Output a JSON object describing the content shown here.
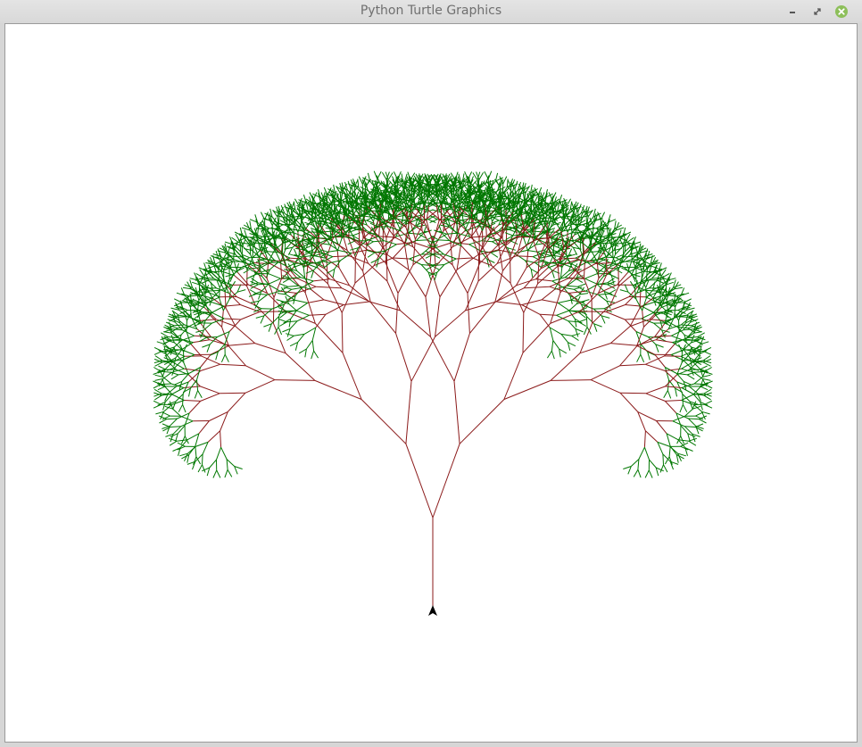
{
  "window": {
    "title": "Python Turtle Graphics",
    "controls": [
      "minimize-icon",
      "restore-icon",
      "close-icon"
    ]
  },
  "canvas": {
    "background": "#ffffff",
    "drawing": "fractal-tree",
    "colors": {
      "trunk_branches": "#8b1a1a",
      "leaves": "#007700",
      "turtle": "#000000",
      "close_button": "#8dbf5a"
    },
    "turtle_icon": "turtle-arrow-icon"
  }
}
